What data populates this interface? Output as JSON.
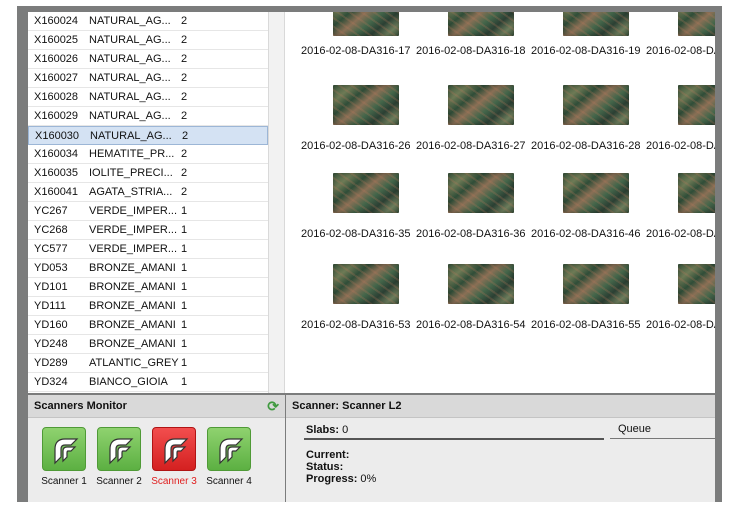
{
  "list": {
    "rows": [
      {
        "code": "X160024",
        "name": "NATURAL_AG...",
        "count": "2"
      },
      {
        "code": "X160025",
        "name": "NATURAL_AG...",
        "count": "2"
      },
      {
        "code": "X160026",
        "name": "NATURAL_AG...",
        "count": "2"
      },
      {
        "code": "X160027",
        "name": "NATURAL_AG...",
        "count": "2"
      },
      {
        "code": "X160028",
        "name": "NATURAL_AG...",
        "count": "2"
      },
      {
        "code": "X160029",
        "name": "NATURAL_AG...",
        "count": "2"
      },
      {
        "code": "X160030",
        "name": "NATURAL_AG...",
        "count": "2"
      },
      {
        "code": "X160034",
        "name": "HEMATITE_PR...",
        "count": "2"
      },
      {
        "code": "X160035",
        "name": "IOLITE_PRECI...",
        "count": "2"
      },
      {
        "code": "X160041",
        "name": "AGATA_STRIA...",
        "count": "2"
      },
      {
        "code": "YC267",
        "name": "VERDE_IMPER...",
        "count": "1"
      },
      {
        "code": "YC268",
        "name": "VERDE_IMPER...",
        "count": "1"
      },
      {
        "code": "YC577",
        "name": "VERDE_IMPER...",
        "count": "1"
      },
      {
        "code": "YD053",
        "name": "BRONZE_AMANI",
        "count": "1"
      },
      {
        "code": "YD101",
        "name": "BRONZE_AMANI",
        "count": "1"
      },
      {
        "code": "YD111",
        "name": "BRONZE_AMANI",
        "count": "1"
      },
      {
        "code": "YD160",
        "name": "BRONZE_AMANI",
        "count": "1"
      },
      {
        "code": "YD248",
        "name": "BRONZE_AMANI",
        "count": "1"
      },
      {
        "code": "YD289",
        "name": "ATLANTIC_GREY",
        "count": "1"
      },
      {
        "code": "YD324",
        "name": "BIANCO_GIOIA",
        "count": "1"
      }
    ],
    "selected_index": 6
  },
  "gallery": {
    "rows": [
      [
        "2016-02-08-DA316-17",
        "2016-02-08-DA316-18",
        "2016-02-08-DA316-19",
        "2016-02-08-DA"
      ],
      [
        "2016-02-08-DA316-26",
        "2016-02-08-DA316-27",
        "2016-02-08-DA316-28",
        "2016-02-08-DA"
      ],
      [
        "2016-02-08-DA316-35",
        "2016-02-08-DA316-36",
        "2016-02-08-DA316-46",
        "2016-02-08-DA"
      ],
      [
        "2016-02-08-DA316-53",
        "2016-02-08-DA316-54",
        "2016-02-08-DA316-55",
        "2016-02-08-DA"
      ]
    ]
  },
  "scanners_monitor": {
    "title": "Scanners Monitor",
    "refresh_icon": "refresh-icon",
    "scanners": [
      {
        "label": "Scanner 1",
        "status": "ok"
      },
      {
        "label": "Scanner 2",
        "status": "ok"
      },
      {
        "label": "Scanner 3",
        "status": "error"
      },
      {
        "label": "Scanner 4",
        "status": "ok"
      }
    ],
    "colors": {
      "ok": "#6cc04a",
      "error": "#e02a2a"
    }
  },
  "scanner_detail": {
    "title": "Scanner: Scanner L2",
    "slabs_label": "Slabs:",
    "slabs_value": "0",
    "queue_label": "Queue",
    "current_label": "Current:",
    "status_label": "Status:",
    "progress_label": "Progress:",
    "progress_value": "0%"
  }
}
